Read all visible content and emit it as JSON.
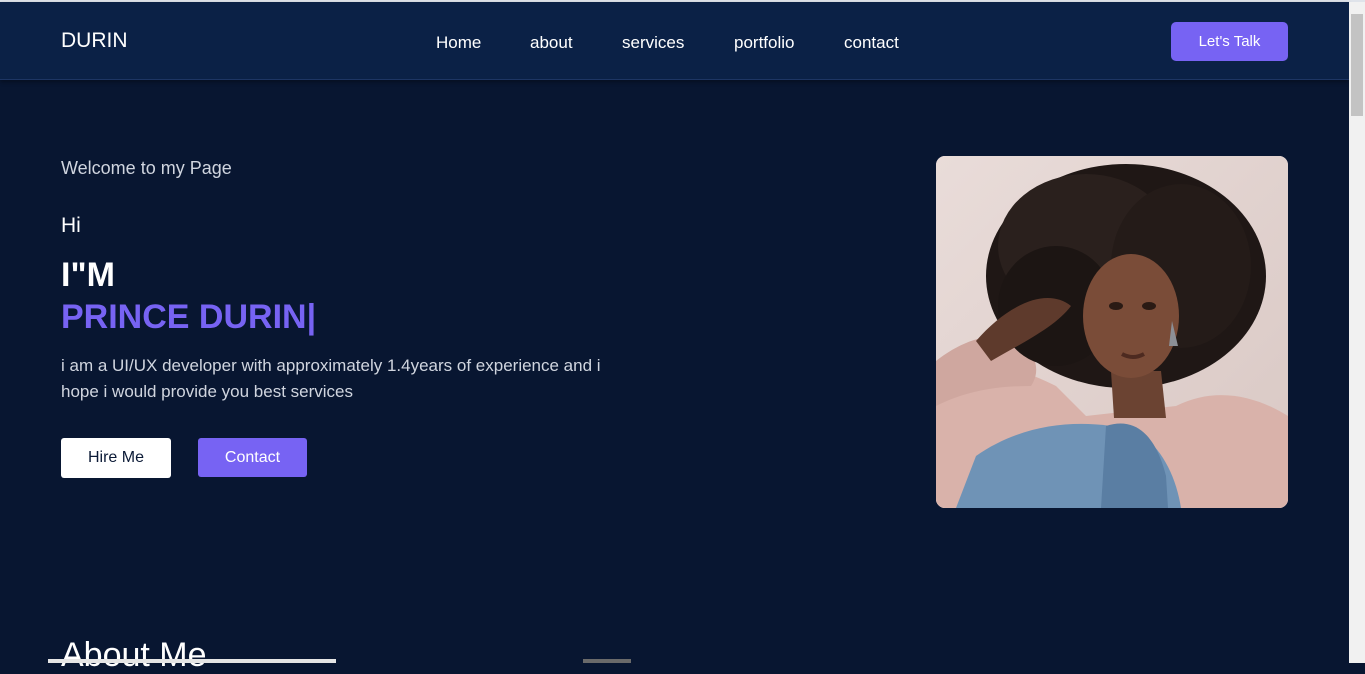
{
  "nav": {
    "brand": "DURIN",
    "links": [
      "Home",
      "about",
      "services",
      "portfolio",
      "contact"
    ],
    "cta_label": "Let's Talk"
  },
  "hero": {
    "welcome": "Welcome to my Page",
    "greeting": "Hi",
    "im": "I\"M",
    "name": "PRINCE DURIN|",
    "description": "i am a UI/UX developer with approximately 1.4years of experience and i hope i would provide you best services",
    "hire_label": "Hire Me",
    "contact_label": "Contact"
  },
  "about": {
    "heading": "About Me"
  },
  "colors": {
    "background": "#081631",
    "navbar": "#0b2146",
    "accent": "#7763f3",
    "muted_text": "#d0d5df"
  },
  "icons": {
    "photo": "profile-photo"
  }
}
